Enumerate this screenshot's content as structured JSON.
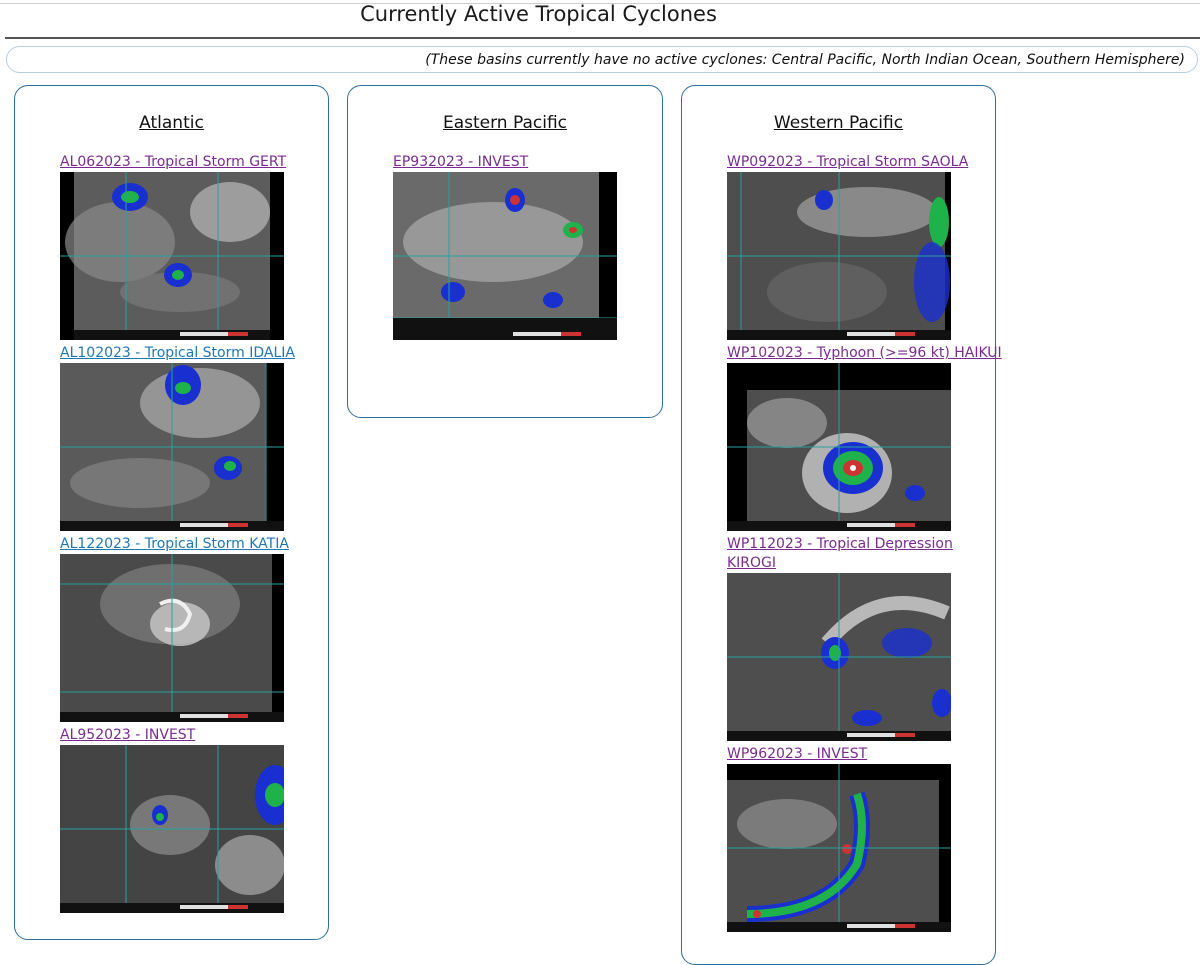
{
  "page": {
    "title": "Currently Active Tropical Cyclones",
    "notice": "(These basins currently have no active cyclones: Central Pacific, North Indian Ocean, Southern Hemisphere)"
  },
  "basins": [
    {
      "name": "Atlantic",
      "storms": [
        {
          "label": "AL062023 - Tropical Storm GERT",
          "visited": true
        },
        {
          "label": "AL102023 - Tropical Storm IDALIA",
          "visited": false
        },
        {
          "label": "AL122023 - Tropical Storm KATIA",
          "visited": false
        },
        {
          "label": "AL952023 - INVEST",
          "visited": true
        }
      ]
    },
    {
      "name": "Eastern Pacific",
      "storms": [
        {
          "label": "EP932023 - INVEST",
          "visited": true
        }
      ]
    },
    {
      "name": "Western Pacific",
      "storms": [
        {
          "label": "WP092023 - Tropical Storm SAOLA",
          "visited": true
        },
        {
          "label": "WP102023 - Typhoon (>=96 kt) HAIKUI",
          "visited": true
        },
        {
          "label": "WP112023 - Tropical Depression KIROGI",
          "visited": true
        },
        {
          "label": "WP962023 - INVEST",
          "visited": true
        }
      ]
    }
  ],
  "colors": {
    "visited_link": "#7a2b8f",
    "unvisited_link": "#1f77b4",
    "panel_border": "#2a6f97"
  }
}
